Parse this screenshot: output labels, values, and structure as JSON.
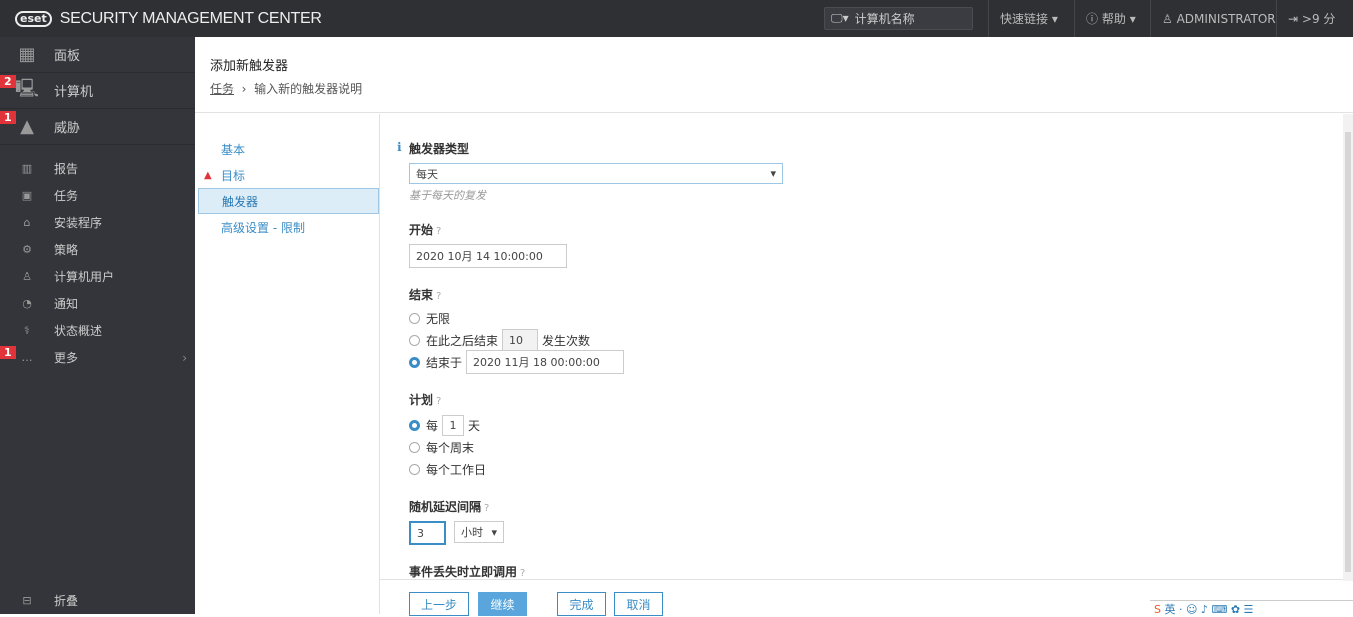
{
  "header": {
    "logo": "eset",
    "app_title": "SECURITY MANAGEMENT CENTER",
    "search_placeholder": "计算机名称",
    "quick_links": "快速链接",
    "help": "帮助",
    "user": "ADMINISTRATOR",
    "session": ">9 分"
  },
  "sidebar": {
    "items": [
      {
        "label": "面板",
        "icon": "dashboard-icon"
      },
      {
        "label": "计算机",
        "icon": "computers-icon",
        "badge": "2"
      },
      {
        "label": "威胁",
        "icon": "warning-icon",
        "badge": "1"
      },
      {
        "label": "报告",
        "icon": "reports-icon"
      },
      {
        "label": "任务",
        "icon": "tasks-icon"
      },
      {
        "label": "安装程序",
        "icon": "installer-icon"
      },
      {
        "label": "策略",
        "icon": "policy-icon"
      },
      {
        "label": "计算机用户",
        "icon": "user-icon"
      },
      {
        "label": "通知",
        "icon": "bell-icon"
      },
      {
        "label": "状态概述",
        "icon": "status-icon"
      },
      {
        "label": "更多",
        "icon": "more-icon",
        "badge": "1"
      }
    ],
    "collapse": "折叠"
  },
  "page": {
    "title": "添加新触发器",
    "breadcrumb_root": "任务",
    "breadcrumb_current": "输入新的触发器说明"
  },
  "steps": [
    {
      "label": "基本"
    },
    {
      "label": "目标",
      "warning": true
    },
    {
      "label": "触发器",
      "active": true
    },
    {
      "label": "高级设置 - 限制"
    }
  ],
  "form": {
    "trigger_type_label": "触发器类型",
    "trigger_type_value": "每天",
    "trigger_type_hint": "基于每天的复发",
    "start_label": "开始",
    "start_value": "2020 10月 14 10:00:00",
    "end_label": "结束",
    "end_infinite": "无限",
    "end_after": "在此之后结束",
    "end_after_count": "10",
    "end_after_suffix": "发生次数",
    "end_at": "结束于",
    "end_at_value": "2020 11月 18 00:00:00",
    "schedule_label": "计划",
    "every": "每",
    "every_value": "1",
    "every_unit": "天",
    "weekend": "每个周末",
    "workday": "每个工作日",
    "delay_label": "随机延迟间隔",
    "delay_value": "3",
    "delay_unit": "小时",
    "missed_label": "事件丢失时立即调用"
  },
  "footer": {
    "back": "上一步",
    "continue": "继续",
    "finish": "完成",
    "cancel": "取消"
  },
  "colors": {
    "accent": "#3a8dc6",
    "header": "#2e3034",
    "sidebar": "#33353a",
    "badge": "#e0343a"
  }
}
